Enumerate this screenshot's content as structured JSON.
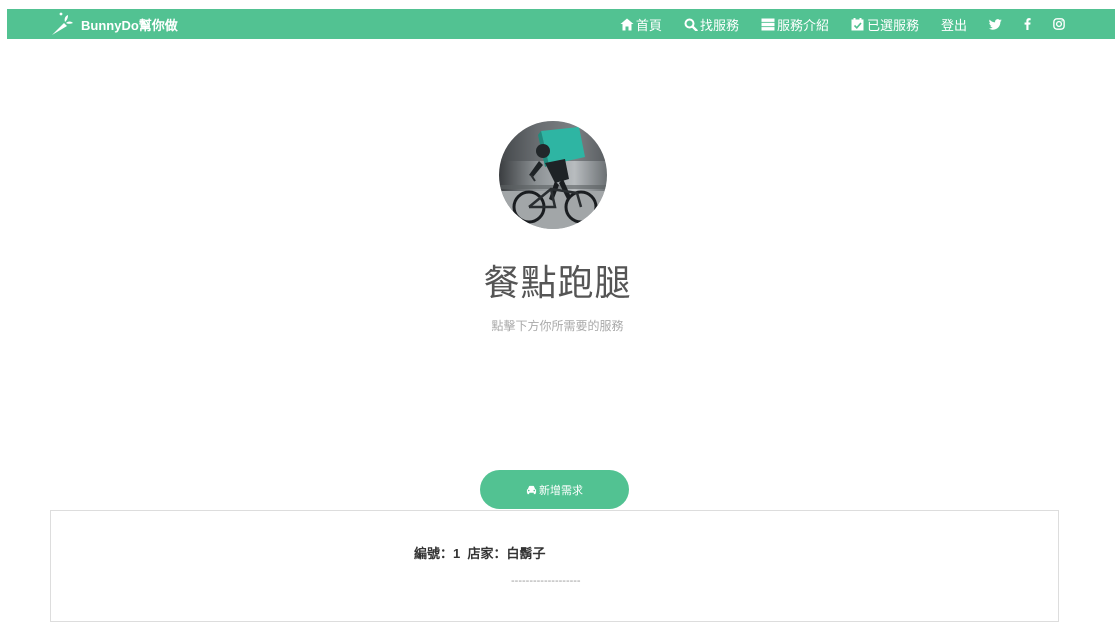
{
  "brand": {
    "name": "BunnyDo幫你做"
  },
  "nav": {
    "items": [
      {
        "label": "首頁",
        "icon": "home-icon"
      },
      {
        "label": "找服務",
        "icon": "search-icon"
      },
      {
        "label": "服務介紹",
        "icon": "server-icon"
      },
      {
        "label": "已選服務",
        "icon": "calendar-check-icon"
      },
      {
        "label": "登出"
      }
    ],
    "social": [
      "twitter-icon",
      "facebook-icon",
      "instagram-icon"
    ]
  },
  "hero": {
    "title": "餐點跑腿",
    "subtitle": "點擊下方你所需要的服務"
  },
  "actions": {
    "add_label": "新增需求"
  },
  "order": {
    "id_label": "編號：",
    "id_value": "1",
    "store_label": "店家：",
    "store_value": "白鬍子",
    "separator": "-------------------"
  },
  "colors": {
    "primary": "#52c292",
    "text": "#555555",
    "muted": "#a9a9a9",
    "border": "#dddddd"
  }
}
